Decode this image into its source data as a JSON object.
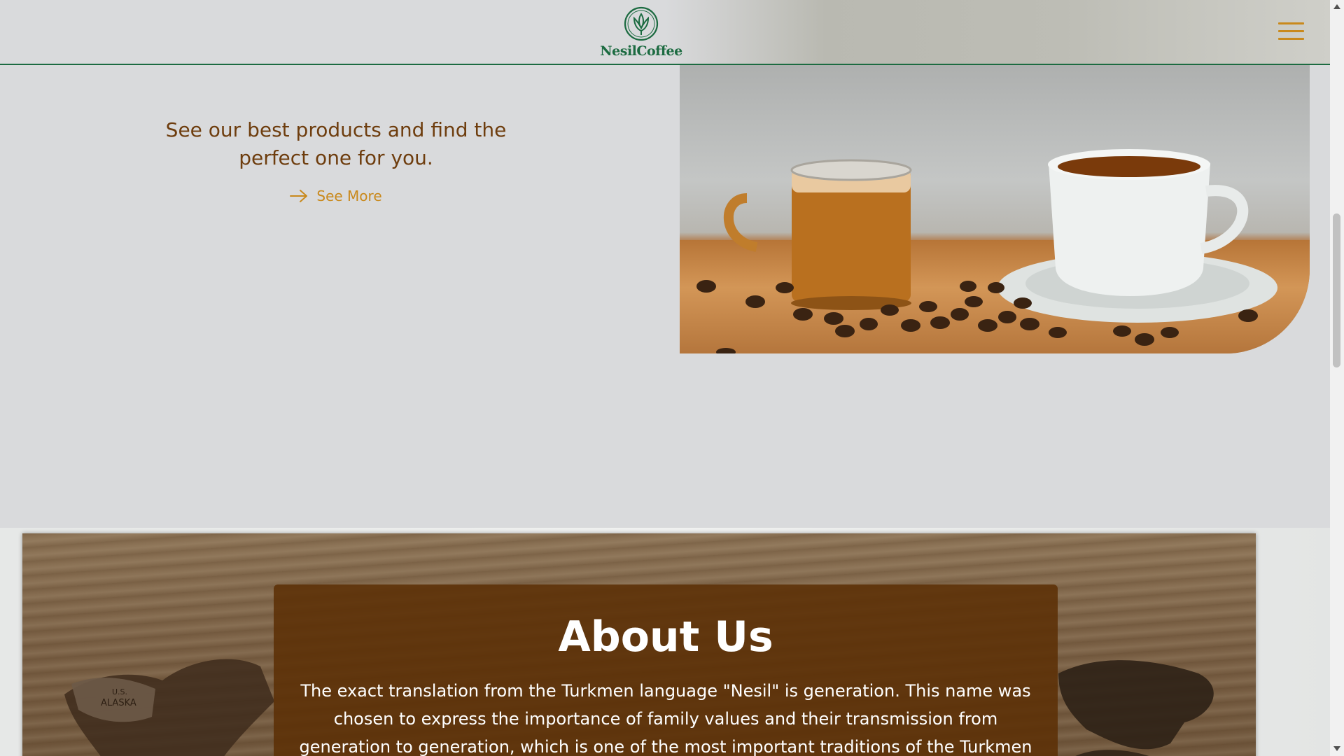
{
  "header": {
    "logo_text": "NesilCoffee",
    "logo_icon": "tulip-emblem-icon",
    "menu_icon": "hamburger-menu-icon"
  },
  "hero": {
    "heading": "See our best products and find the perfect one for you.",
    "cta_label": "See More",
    "cta_icon": "arrow-right-icon",
    "image_alt": "coffee-cups-with-beans-photo"
  },
  "about": {
    "title": "About Us",
    "text": "The exact translation from the Turkmen language \"Nesil\" is generation. This name was chosen to express the importance of family values and their transmission from generation to generation, which is one of the most important traditions of the Turkmen people. The",
    "map_labels": [
      "ALASKA",
      "U.S."
    ]
  },
  "colors": {
    "brand_green": "#1c6b41",
    "accent_gold": "#c9891c",
    "heading_brown": "#6e3d0e",
    "card_brown": "#5c3006",
    "page_bg": "#d9dadc"
  }
}
